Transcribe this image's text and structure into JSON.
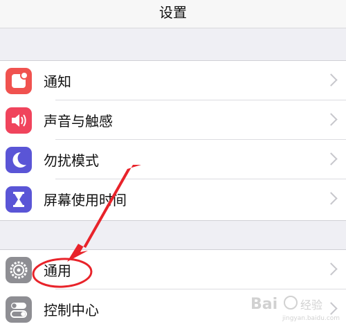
{
  "navbar": {
    "title": "设置"
  },
  "group1": [
    {
      "label": "通知",
      "icon": "notifications-icon",
      "color": "#f0524f"
    },
    {
      "label": "声音与触感",
      "icon": "speaker-icon",
      "color": "#f0445c"
    },
    {
      "label": "勿扰模式",
      "icon": "moon-icon",
      "color": "#5a55d6"
    },
    {
      "label": "屏幕使用时间",
      "icon": "hourglass-icon",
      "color": "#5a55d6"
    }
  ],
  "group2": [
    {
      "label": "通用",
      "icon": "gear-icon",
      "color": "#8e8e93"
    },
    {
      "label": "控制中心",
      "icon": "switches-icon",
      "color": "#8e8e93"
    }
  ],
  "annotation": {
    "color": "#e8232a"
  },
  "watermark": {
    "brand": "Baidu 经验",
    "url": "jingyan.baidu.com"
  }
}
